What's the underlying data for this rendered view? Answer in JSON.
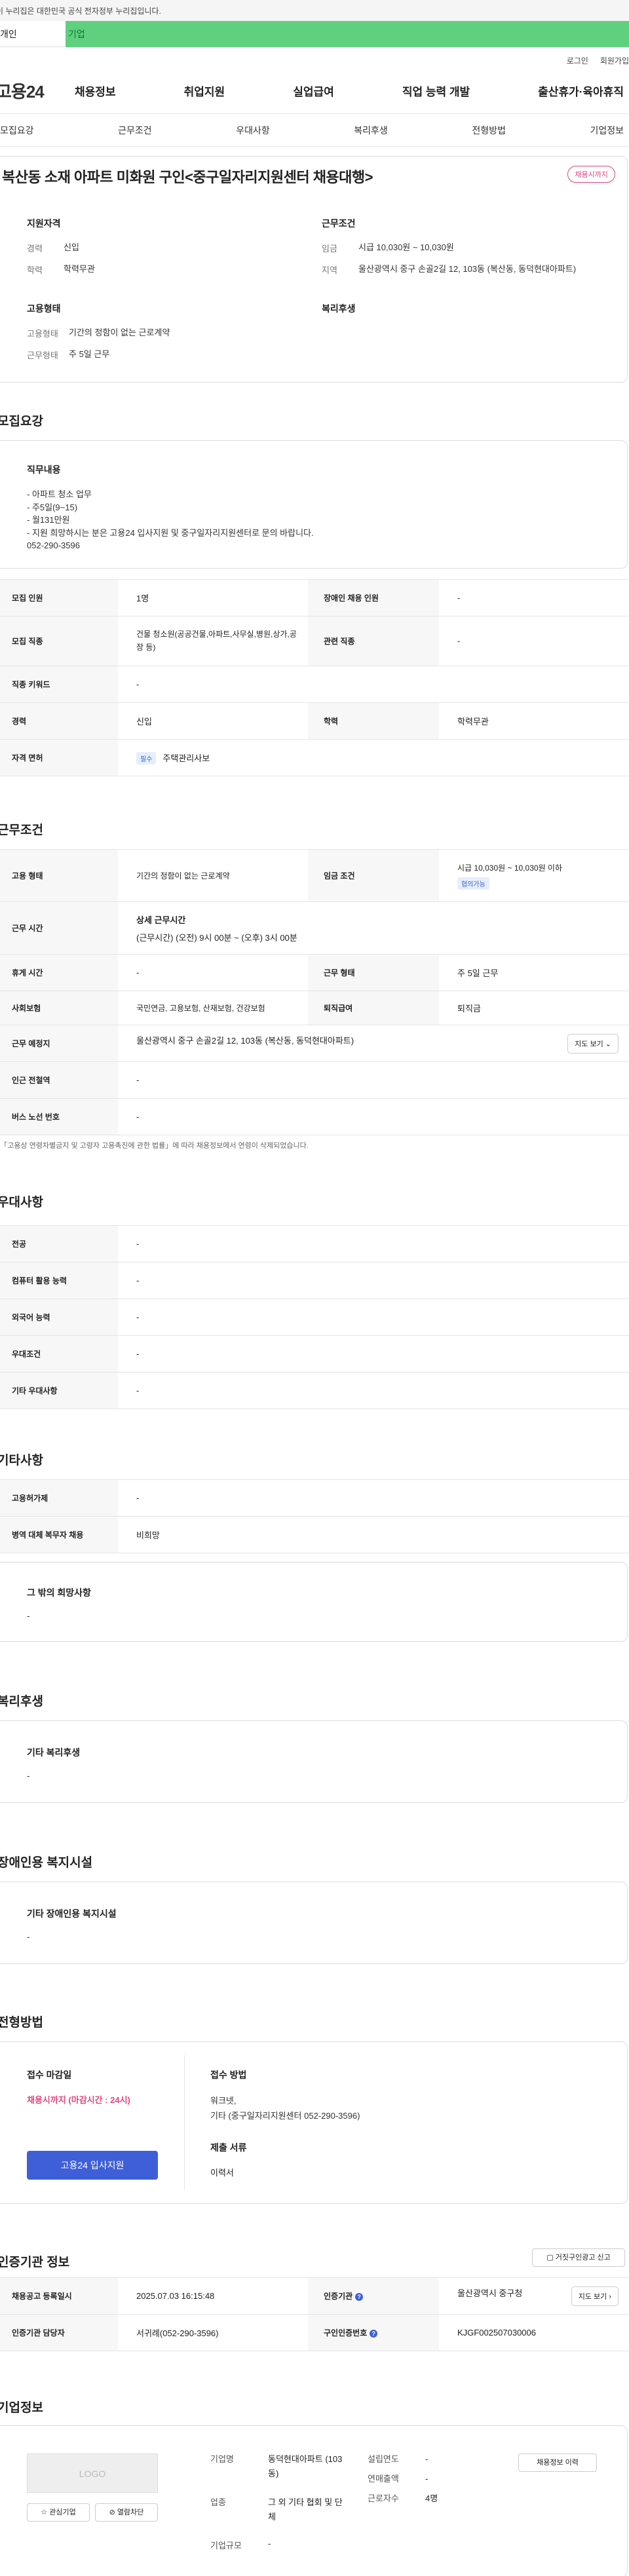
{
  "top": {
    "gov_banner": "이 누리집은 대한민국 공식 전자정부 누리집입니다.",
    "tab_personal": "개인",
    "tab_company": "기업",
    "login": "로그인",
    "signup": "회원가입",
    "logo": "고용24",
    "gnb": [
      "채용정보",
      "취업지원",
      "실업급여",
      "직업 능력 개발",
      "출산휴가·육아휴직"
    ],
    "subnav": [
      "모집요강",
      "근무조건",
      "우대사항",
      "복리후생",
      "전형방법",
      "기업정보"
    ]
  },
  "summary": {
    "title": "복산동 소재 아파트 미화원 구인<중구일자리지원센터 채용대행>",
    "status_badge": "채용시까지",
    "qual_title": "지원자격",
    "career_k": "경력",
    "career_v": "신입",
    "edu_k": "학력",
    "edu_v": "학력무관",
    "work_title": "근무조건",
    "wage_k": "임금",
    "wage_v": "시급 10,030원 ~ 10,030원",
    "area_k": "지역",
    "area_v": "울산광역시 중구 손골2길 12, 103동 (복산동, 동덕현대아파트)",
    "emp_title": "고용형태",
    "emptype_k": "고용형태",
    "emptype_v": "기간의 정함이 없는 근로계약",
    "worktype_k": "근무형태",
    "worktype_v": "주 5일 근무",
    "welfare_title": "복리후생"
  },
  "recruit": {
    "section": "모집요강",
    "duty_title": "직무내용",
    "duty_lines": [
      "- 아파트 청소 업무",
      "- 주5일(9~15)",
      "- 월131만원",
      "- 지원 희망하시는 분은 고용24 입사지원 및 중구일자리지원센터로 문의 바랍니다.",
      "052-290-3596"
    ],
    "rows": {
      "count_k": "모집 인원",
      "count_v": "1명",
      "disabled_k": "장애인 채용 인원",
      "disabled_v": "-",
      "job_k": "모집 직종",
      "job_v": "건물 청소원(공공건물,아파트,사무실,병원,상가,공장 등)",
      "related_k": "관련 직종",
      "related_v": "-",
      "keyword_k": "직종 키워드",
      "keyword_v": "-",
      "career_k": "경력",
      "career_v": "신입",
      "edu_k": "학력",
      "edu_v": "학력무관",
      "license_k": "자격 면허",
      "license_pill": "필수",
      "license_v": "주택관리사보"
    }
  },
  "conditions": {
    "section": "근무조건",
    "emptype_k": "고용 형태",
    "emptype_v": "기간의 정함이 없는 근로계약",
    "wage_k": "임금 조건",
    "wage_v": "시급 10,030원 ~ 10,030원 이하",
    "wage_pill": "협의가능",
    "hours_k": "근무 시간",
    "hours_title": "상세 근무시간",
    "hours_v": "(근무시간) (오전) 9시 00분 ~ (오후) 3시 00분",
    "break_k": "휴게 시간",
    "break_v": "-",
    "worktype_k": "근무 형태",
    "worktype_v": "주 5일 근무",
    "insurance_k": "사회보험",
    "insurance_v": "국민연금, 고용보험, 산재보험, 건강보험",
    "severance_k": "퇴직급여",
    "severance_v": "퇴직금",
    "place_k": "근무 예정지",
    "place_v": "울산광역시 중구 손골2길 12, 103동 (복산동, 동덕현대아파트)",
    "map_btn": "지도 보기",
    "subway_k": "인근 전철역",
    "subway_v": "-",
    "bus_k": "버스 노선 번호",
    "bus_v": "-",
    "note": "*「고용상 연령차별금지 및 고령자 고용촉진에 관한 법률」에 따라 채용정보에서 연령이 삭제되었습니다."
  },
  "prefer": {
    "section": "우대사항",
    "rows": [
      [
        "전공",
        "-"
      ],
      [
        "컴퓨터 활용 능력",
        "-"
      ],
      [
        "외국어 능력",
        "-"
      ],
      [
        "우대조건",
        "-"
      ],
      [
        "기타 우대사항",
        "-"
      ]
    ]
  },
  "etc": {
    "section": "기타사항",
    "rows": [
      [
        "고용허가제",
        "-"
      ],
      [
        "병역 대체 복무자 채용",
        "비희망"
      ]
    ],
    "other_title": "그 밖의 희망사항",
    "other_v": "-"
  },
  "welfare": {
    "section": "복리후생",
    "title": "기타 복리후생",
    "v": "-"
  },
  "disabled": {
    "section": "장애인용 복지시설",
    "title": "기타 장애인용 복지시설",
    "v": "-"
  },
  "selection": {
    "section": "전형방법",
    "deadline_title": "접수 마감일",
    "deadline_v": "채용시까지 (마감시간 : 24시)",
    "apply_btn": "고용24 입사지원",
    "method_title": "접수 방법",
    "method_v1": "워크넷,",
    "method_v2": "기타 (중구일자리지원센터 052-290-3596)",
    "docs_title": "제출 서류",
    "docs_v": "이력서"
  },
  "cert": {
    "section": "인증기관 정보",
    "report_btn": "거짓구인광고 신고",
    "reg_k": "채용공고 등록일시",
    "reg_v": "2025.07.03 16:15:48",
    "org_k": "인증기관",
    "org_v": "울산광역시 중구청",
    "map_btn": "지도 보기",
    "mgr_k": "인증기관 담당자",
    "mgr_v": "서귀례(052-290-3596)",
    "cert_k": "구인인증번호",
    "cert_v": "KJGF002507030006"
  },
  "company": {
    "section": "기업정보",
    "logo": "LOGO",
    "fav_btn": "관심기업",
    "block_btn": "열람차단",
    "history_btn": "채용정보 이력",
    "name_k": "기업명",
    "name_v": "동덕현대아파트 (103동)",
    "founded_k": "설립연도",
    "founded_v": "-",
    "sales_k": "연매출액",
    "sales_v": "-",
    "industry_k": "업종",
    "industry_v": "그 외 기타 협회 및 단체",
    "staff_k": "근로자수",
    "staff_v": "4명",
    "size_k": "기업규모",
    "size_v": "-"
  }
}
